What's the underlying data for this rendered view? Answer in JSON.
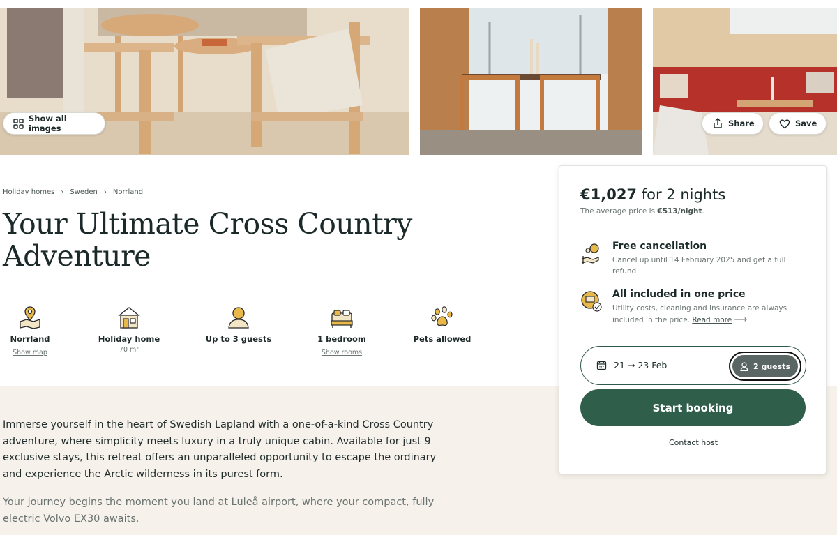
{
  "gallery": {
    "show_all_label": "Show all images",
    "share_label": "Share",
    "save_label": "Save"
  },
  "breadcrumb": [
    {
      "label": "Holiday homes"
    },
    {
      "label": "Sweden"
    },
    {
      "label": "Norrland"
    }
  ],
  "title": "Your Ultimate Cross Country Adventure",
  "features": [
    {
      "label": "Norrland",
      "sub": "Show map",
      "icon": "map-pin-icon"
    },
    {
      "label": "Holiday home",
      "sub": "70 m²",
      "icon": "house-icon"
    },
    {
      "label": "Up to 3 guests",
      "sub": "",
      "icon": "guest-icon"
    },
    {
      "label": "1 bedroom",
      "sub": "Show rooms",
      "icon": "bed-icon"
    },
    {
      "label": "Pets allowed",
      "sub": "",
      "icon": "paw-icon"
    }
  ],
  "description": {
    "paragraph_1": "Immerse yourself in the heart of Swedish Lapland with a one-of-a-kind Cross Country adventure, where simplicity meets luxury in a truly unique cabin. Available for just 9 exclusive stays, this retreat offers an unparalleled opportunity to escape the ordinary and experience the Arctic wilderness in its purest form.",
    "paragraph_2": "Your journey begins the moment you land at Luleå airport, where your compact, fully electric Volvo EX30 awaits."
  },
  "booking": {
    "price": "€1,027",
    "price_suffix": "for 2 nights",
    "avg_prefix": "The average price is",
    "avg_price": "€513/night",
    "avg_end": ".",
    "perks": [
      {
        "title": "Free cancellation",
        "text": "Cancel up until 14 February 2025 and get a full refund",
        "link": ""
      },
      {
        "title": "All included in one price",
        "text": "Utility costs, cleaning and insurance are always included in the price.",
        "link": "Read more"
      }
    ],
    "dates": "21 → 23 Feb",
    "guests": "2 guests",
    "start_label": "Start booking",
    "contact_label": "Contact host"
  },
  "colors": {
    "accent": "#2f5e4b",
    "band": "#f6f1ea",
    "guests_button": "#5a6663"
  }
}
